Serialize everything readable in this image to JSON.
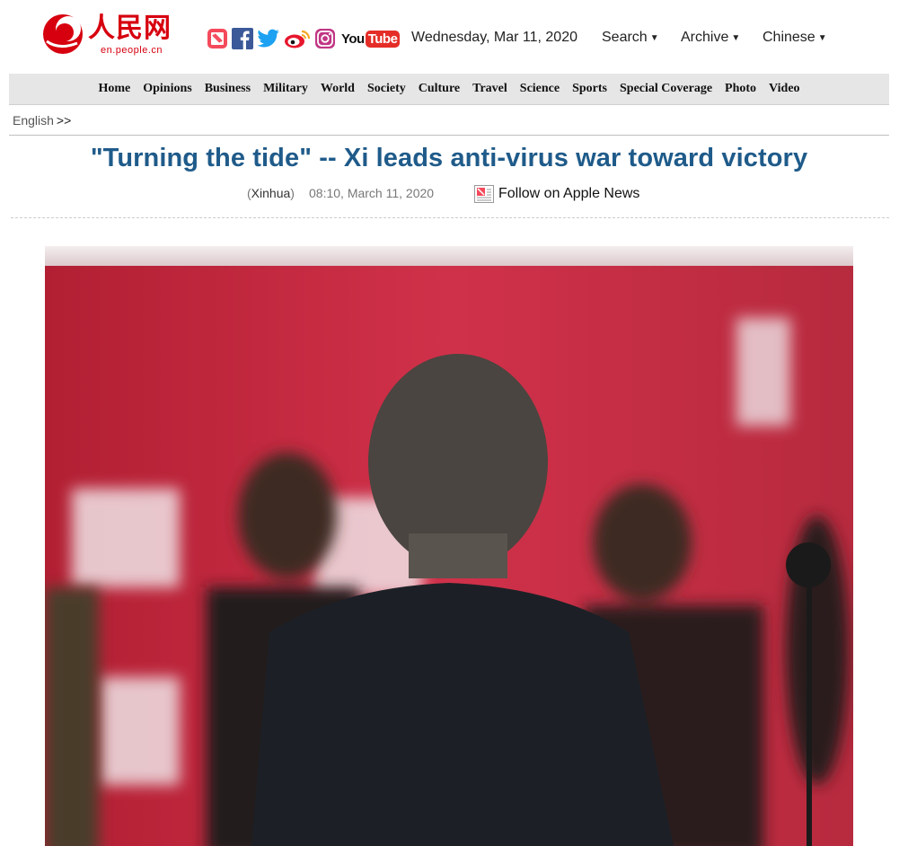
{
  "logo": {
    "cn_text": "人民网",
    "domain": "en.people.cn",
    "brand_color": "#d7000f"
  },
  "social": {
    "icons": [
      "apple-news-icon",
      "facebook-icon",
      "twitter-icon",
      "weibo-icon",
      "instagram-icon"
    ],
    "youtube_you": "You",
    "youtube_tube": "Tube"
  },
  "header": {
    "date": "Wednesday, Mar 11, 2020",
    "search": "Search",
    "archive": "Archive",
    "chinese": "Chinese"
  },
  "nav": {
    "items": [
      "Home",
      "Opinions",
      "Business",
      "Military",
      "World",
      "Society",
      "Culture",
      "Travel",
      "Science",
      "Sports",
      "Special Coverage",
      "Photo",
      "Video"
    ]
  },
  "breadcrumb": {
    "label": "English",
    "sep": ">>"
  },
  "article": {
    "headline": "\"Turning the tide\" -- Xi leads anti-virus war toward victory",
    "source_open": "(",
    "source": "Xinhua",
    "source_close": ")",
    "timestamp": "08:10, March 11, 2020",
    "apple_news": "Follow on Apple News"
  },
  "colors": {
    "headline": "#1f5b8a",
    "nav_bg": "#e6e6e6",
    "brand_red": "#d7000f",
    "photo_backdrop": "#c8283c"
  }
}
